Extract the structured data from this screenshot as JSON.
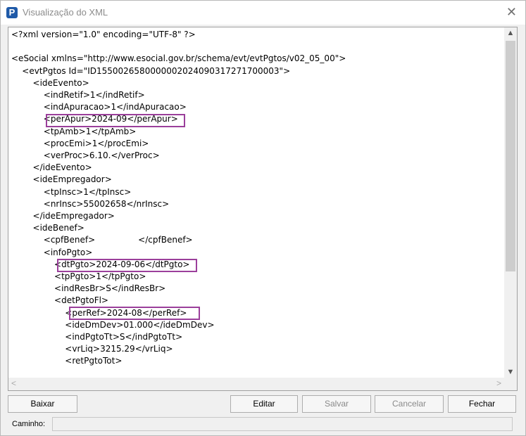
{
  "window": {
    "title": "Visualização do XML",
    "app_icon": "P",
    "close_glyph": "✕"
  },
  "editor": {
    "lines": [
      "<?xml version=\"1.0\" encoding=\"UTF-8\" ?>",
      "",
      "<eSocial xmlns=\"http://www.esocial.gov.br/schema/evt/evtPgtos/v02_05_00\">",
      "    <evtPgtos Id=\"ID1550026580000002024090317271700003\">",
      "        <ideEvento>",
      "            <indRetif>1</indRetif>",
      "            <indApuracao>1</indApuracao>",
      "            <perApur>2024-09</perApur>",
      "            <tpAmb>1</tpAmb>",
      "            <procEmi>1</procEmi>",
      "            <verProc>6.10.</verProc>",
      "        </ideEvento>",
      "        <ideEmpregador>",
      "            <tpInsc>1</tpInsc>",
      "            <nrInsc>55002658</nrInsc>",
      "        </ideEmpregador>",
      "        <ideBenef>",
      "            <cpfBenef>                </cpfBenef>",
      "            <infoPgto>",
      "                <dtPgto>2024-09-06</dtPgto>",
      "                <tpPgto>1</tpPgto>",
      "                <indResBr>S</indResBr>",
      "                <detPgtoFl>",
      "                    <perRef>2024-08</perRef>",
      "                    <ideDmDev>01.000</ideDmDev>",
      "                    <indPgtoTt>S</indPgtoTt>",
      "                    <vrLiq>3215.29</vrLiq>",
      "                    <retPgtoTot>"
    ],
    "highlight_color": "#9b3f9b"
  },
  "scrollbar": {
    "up_glyph": "▲",
    "down_glyph": "▼",
    "left_glyph": "<",
    "right_glyph": ">"
  },
  "buttons": {
    "baixar": "Baixar",
    "editar": "Editar",
    "salvar": "Salvar",
    "cancelar": "Cancelar",
    "fechar": "Fechar"
  },
  "status": {
    "caminho_label": "Caminho:",
    "caminho_value": ""
  }
}
